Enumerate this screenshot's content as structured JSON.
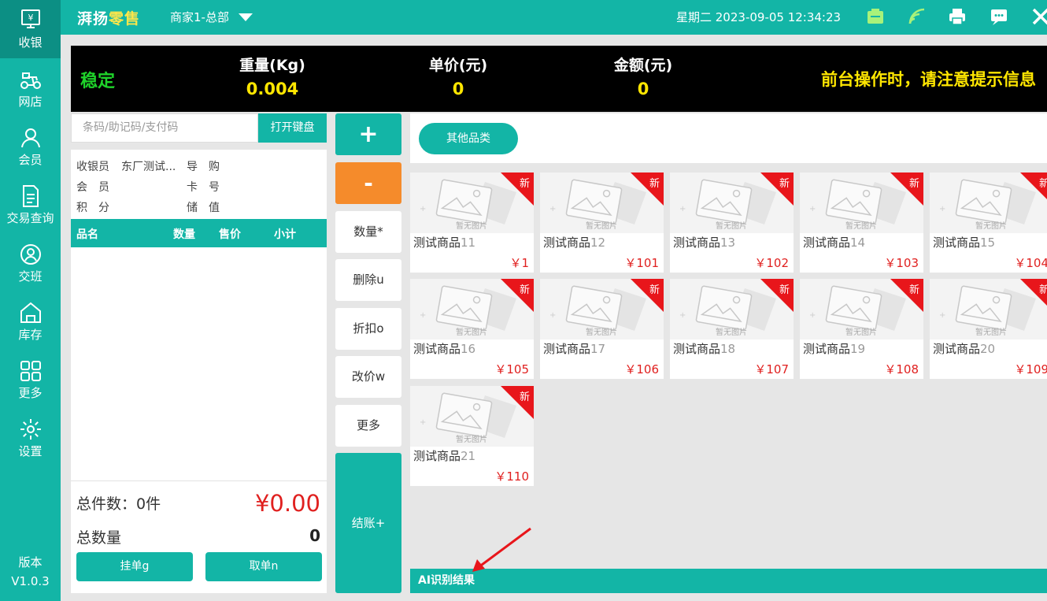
{
  "sidebar": {
    "items": [
      {
        "label": "收银",
        "icon": "cash-register-icon"
      },
      {
        "label": "网店",
        "icon": "scooter-icon"
      },
      {
        "label": "会员",
        "icon": "user-icon"
      },
      {
        "label": "交易查询",
        "icon": "document-icon"
      },
      {
        "label": "交班",
        "icon": "shift-handover-icon"
      },
      {
        "label": "库存",
        "icon": "warehouse-icon"
      },
      {
        "label": "更多",
        "icon": "grid-icon"
      },
      {
        "label": "设置",
        "icon": "gear-icon"
      }
    ],
    "version_label": "版本",
    "version": "V1.0.3"
  },
  "topbar": {
    "app_name_part1": "湃扬",
    "app_name_part2": "零售",
    "merchant": "商家1-总部",
    "datetime": "星期二 2023-09-05 12:34:23",
    "icons": [
      "cash-box-icon",
      "wifi-icon",
      "printer-icon",
      "message-icon",
      "close-icon"
    ]
  },
  "scale": {
    "status": "稳定",
    "weight_label": "重量(Kg)",
    "weight": "0.004",
    "unit_price_label": "单价(元)",
    "unit_price": "0",
    "amount_label": "金额(元)",
    "amount": "0",
    "notice": "前台操作时，请注意提示信息"
  },
  "search": {
    "placeholder": "条码/助记码/支付码",
    "keyboard_button": "打开键盘"
  },
  "info": {
    "cashier_label": "收银员",
    "cashier_value": "东厂测试...",
    "guide_label": "导　购",
    "member_label": "会　员",
    "card_label": "卡　号",
    "points_label": "积　分",
    "stored_label": "储　值"
  },
  "cart": {
    "columns": [
      "品名",
      "数量",
      "售价",
      "小计"
    ],
    "total_items_label": "总件数：",
    "total_items": "0件",
    "total_amount": "¥0.00",
    "total_qty_label": "总数量",
    "total_qty": "0",
    "hold_button": "挂单g",
    "retrieve_button": "取单n"
  },
  "functions": {
    "plus": "+",
    "minus": "-",
    "quantity": "数量*",
    "delete": "删除u",
    "discount": "折扣o",
    "change_price": "改价w",
    "more": "更多",
    "checkout": "结账+"
  },
  "category": {
    "label": "其他品类"
  },
  "products": [
    {
      "name": "测试商品",
      "no": "11",
      "price": "￥1",
      "badge": "新"
    },
    {
      "name": "测试商品",
      "no": "12",
      "price": "￥101",
      "badge": "新"
    },
    {
      "name": "测试商品",
      "no": "13",
      "price": "￥102",
      "badge": "新"
    },
    {
      "name": "测试商品",
      "no": "14",
      "price": "￥103",
      "badge": "新"
    },
    {
      "name": "测试商品",
      "no": "15",
      "price": "￥104",
      "badge": "新"
    },
    {
      "name": "测试商品",
      "no": "16",
      "price": "￥105",
      "badge": "新"
    },
    {
      "name": "测试商品",
      "no": "17",
      "price": "￥106",
      "badge": "新"
    },
    {
      "name": "测试商品",
      "no": "18",
      "price": "￥107",
      "badge": "新"
    },
    {
      "name": "测试商品",
      "no": "19",
      "price": "￥108",
      "badge": "新"
    },
    {
      "name": "测试商品",
      "no": "20",
      "price": "￥109",
      "badge": "新"
    },
    {
      "name": "测试商品",
      "no": "21",
      "price": "￥110",
      "badge": "新"
    }
  ],
  "placeholder_image_text": "暂无图片",
  "ai_bar": {
    "label": "AI识别结果"
  },
  "colors": {
    "primary": "#13b5a6",
    "active_nav": "#0c8f84",
    "warning": "#f58b2b",
    "price": "#e0201f",
    "new_badge": "#e8161b",
    "scale_value": "#ffe600",
    "stable": "#1fd32a"
  }
}
